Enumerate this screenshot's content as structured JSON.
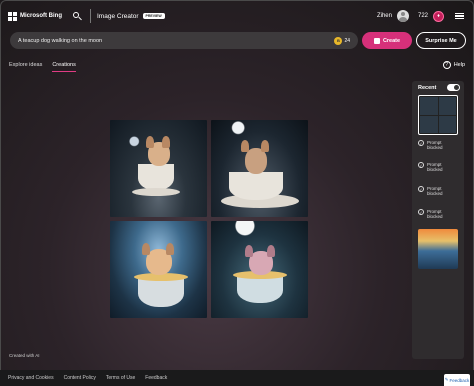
{
  "header": {
    "brand": "Microsoft Bing",
    "search_icon": "search-icon",
    "app_title": "Image Creator",
    "badge": "PREVIEW",
    "username": "Zihen",
    "points": "722",
    "reward_icon": "reward-icon",
    "menu_icon": "hamburger-menu-icon"
  },
  "prompt": {
    "text": "A teacup dog walking on the moon",
    "boosts": "24",
    "create_label": "Create",
    "surprise_label": "Surprise Me"
  },
  "tabs": [
    {
      "label": "Explore ideas",
      "active": false
    },
    {
      "label": "Creations",
      "active": true
    }
  ],
  "help_label": "Help",
  "images": [
    "teacup dog on the moon 1",
    "teacup dog on the moon 2",
    "teacup dog on the moon 3",
    "teacup dog on the moon 4"
  ],
  "recent": {
    "title": "Recent",
    "toggle_on": true,
    "blocked_items": [
      {
        "label": "Prompt blocked"
      },
      {
        "label": "Prompt blocked"
      },
      {
        "label": "Prompt blocked"
      },
      {
        "label": "Prompt blocked"
      }
    ]
  },
  "created_with": "Created with AI",
  "footer": {
    "links": [
      "Privacy and Cookies",
      "Content Policy",
      "Terms of Use",
      "Feedback"
    ],
    "feedback_button": "Feedback"
  },
  "colors": {
    "accent": "#d6307a",
    "reward": "#c4205b"
  }
}
